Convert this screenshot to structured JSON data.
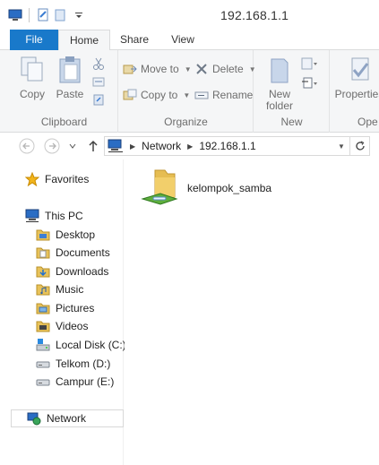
{
  "window": {
    "title": "192.168.1.1"
  },
  "ribbon_tabs": [
    {
      "label": "File"
    },
    {
      "label": "Home"
    },
    {
      "label": "Share"
    },
    {
      "label": "View"
    }
  ],
  "ribbon": {
    "clipboard": {
      "group_label": "Clipboard",
      "copy": "Copy",
      "paste": "Paste"
    },
    "organize": {
      "group_label": "Organize",
      "move_to": "Move to",
      "copy_to": "Copy to",
      "delete": "Delete",
      "rename": "Rename"
    },
    "new": {
      "group_label": "New",
      "new_folder_line1": "New",
      "new_folder_line2": "folder"
    },
    "open": {
      "group_label": "Ope",
      "properties": "Properties"
    }
  },
  "address": {
    "segments": [
      "Network",
      "192.168.1.1"
    ]
  },
  "navpane": {
    "favorites": "Favorites",
    "this_pc": "This PC",
    "items": [
      "Desktop",
      "Documents",
      "Downloads",
      "Music",
      "Pictures",
      "Videos",
      "Local Disk (C:)",
      "Telkom (D:)",
      "Campur (E:)"
    ],
    "network": "Network"
  },
  "files": [
    {
      "name": "kelompok_samba"
    }
  ],
  "colors": {
    "accent": "#1979ca",
    "folder": "#e8c25a"
  }
}
